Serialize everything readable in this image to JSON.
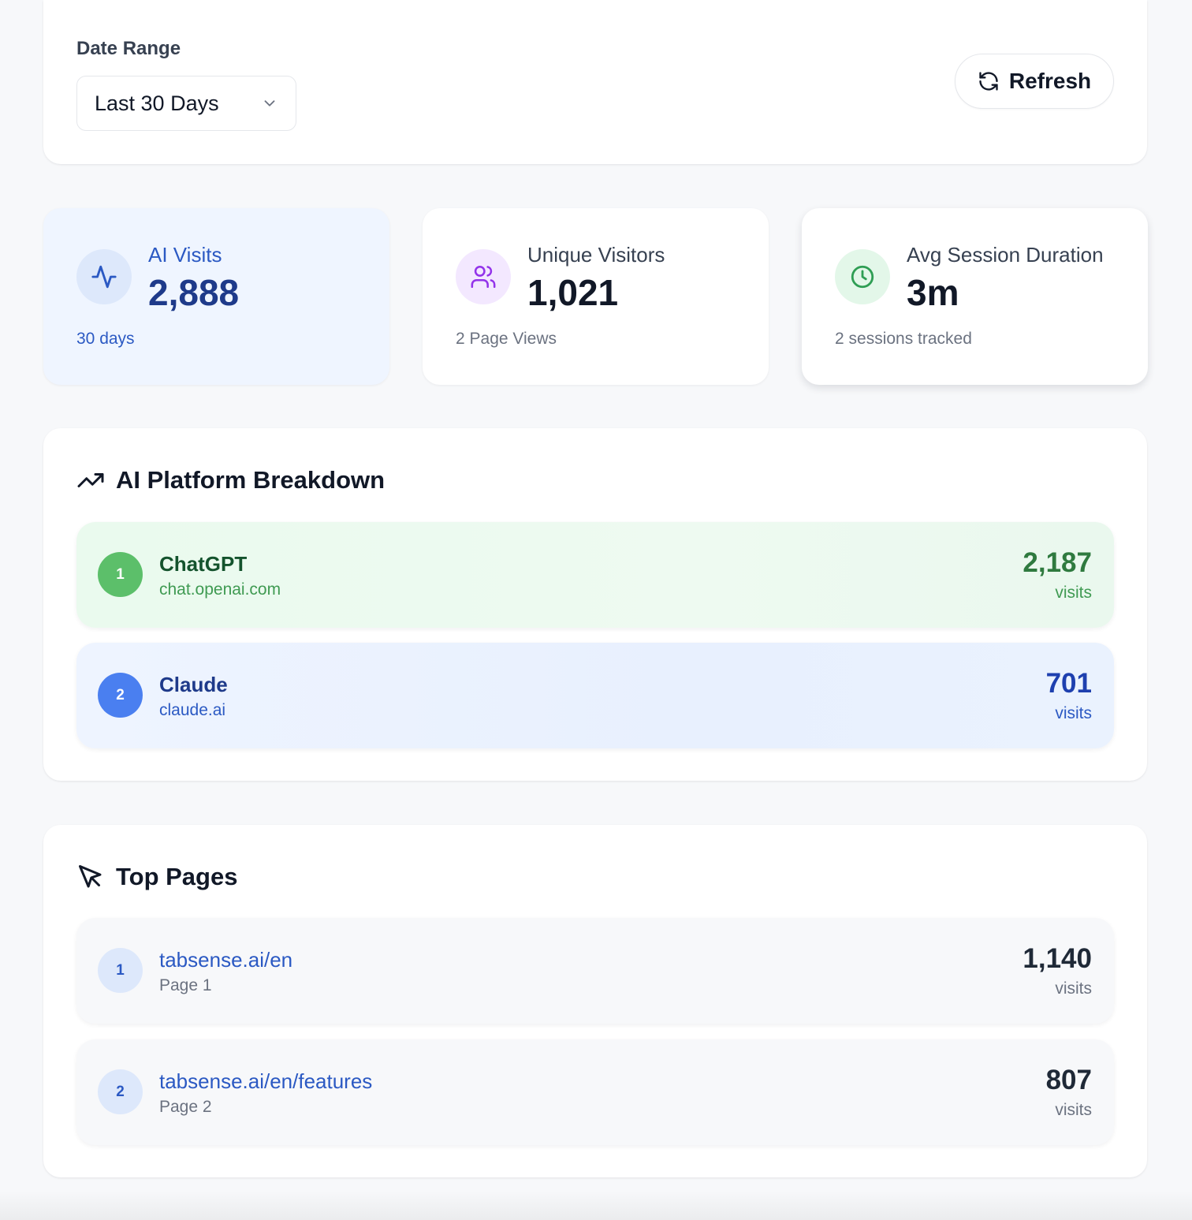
{
  "filter": {
    "label": "Date Range",
    "selected": "Last 30 Days",
    "refresh_label": "Refresh"
  },
  "stats": [
    {
      "label": "AI Visits",
      "value": "2,888",
      "sub": "30 days",
      "icon": "activity-icon",
      "color": "#2b59c3"
    },
    {
      "label": "Unique Visitors",
      "value": "1,021",
      "sub": "2 Page Views",
      "icon": "users-icon",
      "color": "#9333ea"
    },
    {
      "label": "Avg Session Duration",
      "value": "3m",
      "sub": "2 sessions tracked",
      "icon": "clock-icon",
      "color": "#2f9e54"
    }
  ],
  "platforms": {
    "title": "AI Platform Breakdown",
    "icon": "trending-up-icon",
    "items": [
      {
        "rank": "1",
        "name": "ChatGPT",
        "domain": "chat.openai.com",
        "visits": "2,187",
        "unit": "visits",
        "color": "#5cbf6a"
      },
      {
        "rank": "2",
        "name": "Claude",
        "domain": "claude.ai",
        "visits": "701",
        "unit": "visits",
        "color": "#4a7ff0"
      }
    ]
  },
  "top_pages": {
    "title": "Top Pages",
    "icon": "cursor-arrow-icon",
    "items": [
      {
        "rank": "1",
        "url": "tabsense.ai/en",
        "label": "Page 1",
        "visits": "1,140",
        "unit": "visits"
      },
      {
        "rank": "2",
        "url": "tabsense.ai/en/features",
        "label": "Page 2",
        "visits": "807",
        "unit": "visits"
      }
    ]
  }
}
